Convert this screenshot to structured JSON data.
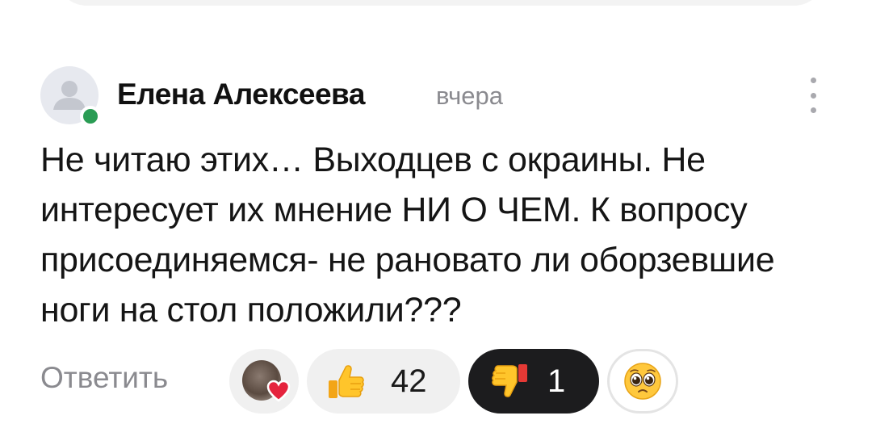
{
  "comment": {
    "author": "Елена Алексеева",
    "time": "вчера",
    "text": "Не читаю этих… Выходцев с окраины. Не интересует их мнение НИ О ЧЕМ. К вопросу присоединяемся- не рановато ли оборзевшие ноги на стол положили???"
  },
  "actions": {
    "reply_label": "Ответить"
  },
  "reactions": {
    "like": {
      "icon": "thumbs-up-emoji",
      "count": "42"
    },
    "dislike": {
      "icon": "thumbs-down-emoji",
      "count": "1",
      "selected": true
    },
    "extra": {
      "icon": "pleading-face-emoji"
    },
    "reactors": {
      "icon": "heart-icon",
      "heart_color": "#e5233d"
    }
  },
  "colors": {
    "online": "#2a9c54",
    "muted_text": "#8a8a8f",
    "selected_chip": "#1c1c1e",
    "chip_bg": "#f0f0f0"
  },
  "icons": {
    "avatar": "user-placeholder-icon",
    "more": "vertical-dots-icon"
  }
}
